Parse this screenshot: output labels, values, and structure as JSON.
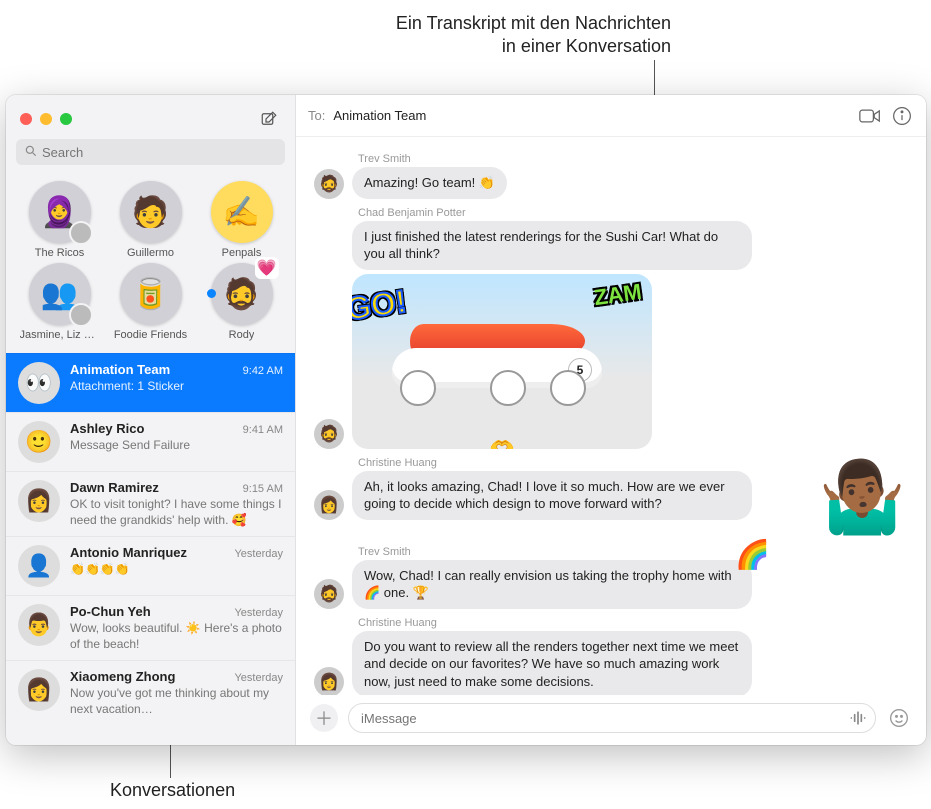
{
  "callouts": {
    "top_line1": "Ein Transkript mit den Nachrichten",
    "top_line2": "in einer Konversation",
    "bottom": "Konversationen"
  },
  "search": {
    "placeholder": "Search"
  },
  "pinned": [
    {
      "label": "The Ricos",
      "emoji": "🧕",
      "badge": true
    },
    {
      "label": "Guillermo",
      "emoji": "🧑",
      "badge": false
    },
    {
      "label": "Penpals",
      "emoji": "✍️",
      "bg": "#ffdc5e"
    },
    {
      "label": "Jasmine, Liz &…",
      "emoji": "👥",
      "badge": true
    },
    {
      "label": "Foodie Friends",
      "emoji": "🥫",
      "badge": false
    },
    {
      "label": "Rody",
      "emoji": "🧔",
      "unread": true,
      "heart": true
    }
  ],
  "conversations": [
    {
      "name": "Animation Team",
      "time": "9:42 AM",
      "sub": "Attachment: 1 Sticker",
      "selected": true,
      "avatar": "👀"
    },
    {
      "name": "Ashley Rico",
      "time": "9:41 AM",
      "sub": "Message Send Failure",
      "avatar": "🙂"
    },
    {
      "name": "Dawn Ramirez",
      "time": "9:15 AM",
      "sub": "OK to visit tonight? I have some things I need the grandkids' help with. 🥰",
      "avatar": "👩"
    },
    {
      "name": "Antonio Manriquez",
      "time": "Yesterday",
      "sub": "👏👏👏👏",
      "avatar": "👤"
    },
    {
      "name": "Po-Chun Yeh",
      "time": "Yesterday",
      "sub": "Wow, looks beautiful. ☀️ Here's a photo of the beach!",
      "avatar": "👨"
    },
    {
      "name": "Xiaomeng Zhong",
      "time": "Yesterday",
      "sub": "Now you've got me thinking about my next vacation…",
      "avatar": "👩"
    }
  ],
  "header": {
    "to_label": "To:",
    "to_value": "Animation Team"
  },
  "messages": [
    {
      "sender": "Trev Smith",
      "avatar": "🧔",
      "text": "Amazing! Go team! 👏",
      "short": true,
      "senderVisible": true
    },
    {
      "sender": "Chad Benjamin Potter",
      "avatar": "",
      "text": "I just finished the latest renderings for the Sushi Car! What do you all think?",
      "senderVisible": true,
      "noavatar": true
    },
    {
      "sender": "",
      "avatar": "🧔",
      "image": true,
      "carNumber": "5",
      "go": "GO!",
      "zam": "ZAM"
    },
    {
      "sender": "Christine Huang",
      "avatar": "👩",
      "text": "Ah, it looks amazing, Chad! I love it so much. How are we ever going to decide which design to move forward with?",
      "senderVisible": true,
      "memoji": true
    },
    {
      "sender": "Trev Smith",
      "avatar": "🧔",
      "text": "Wow, Chad! I can really envision us taking the trophy home with 🌈 one. 🏆",
      "senderVisible": true,
      "rainbow": true
    },
    {
      "sender": "Christine Huang",
      "avatar": "👩",
      "text": "Do you want to review all the renders together next time we meet and decide on our favorites? We have so much amazing work now, just need to make some decisions.",
      "senderVisible": true
    }
  ],
  "composer": {
    "placeholder": "iMessage"
  }
}
